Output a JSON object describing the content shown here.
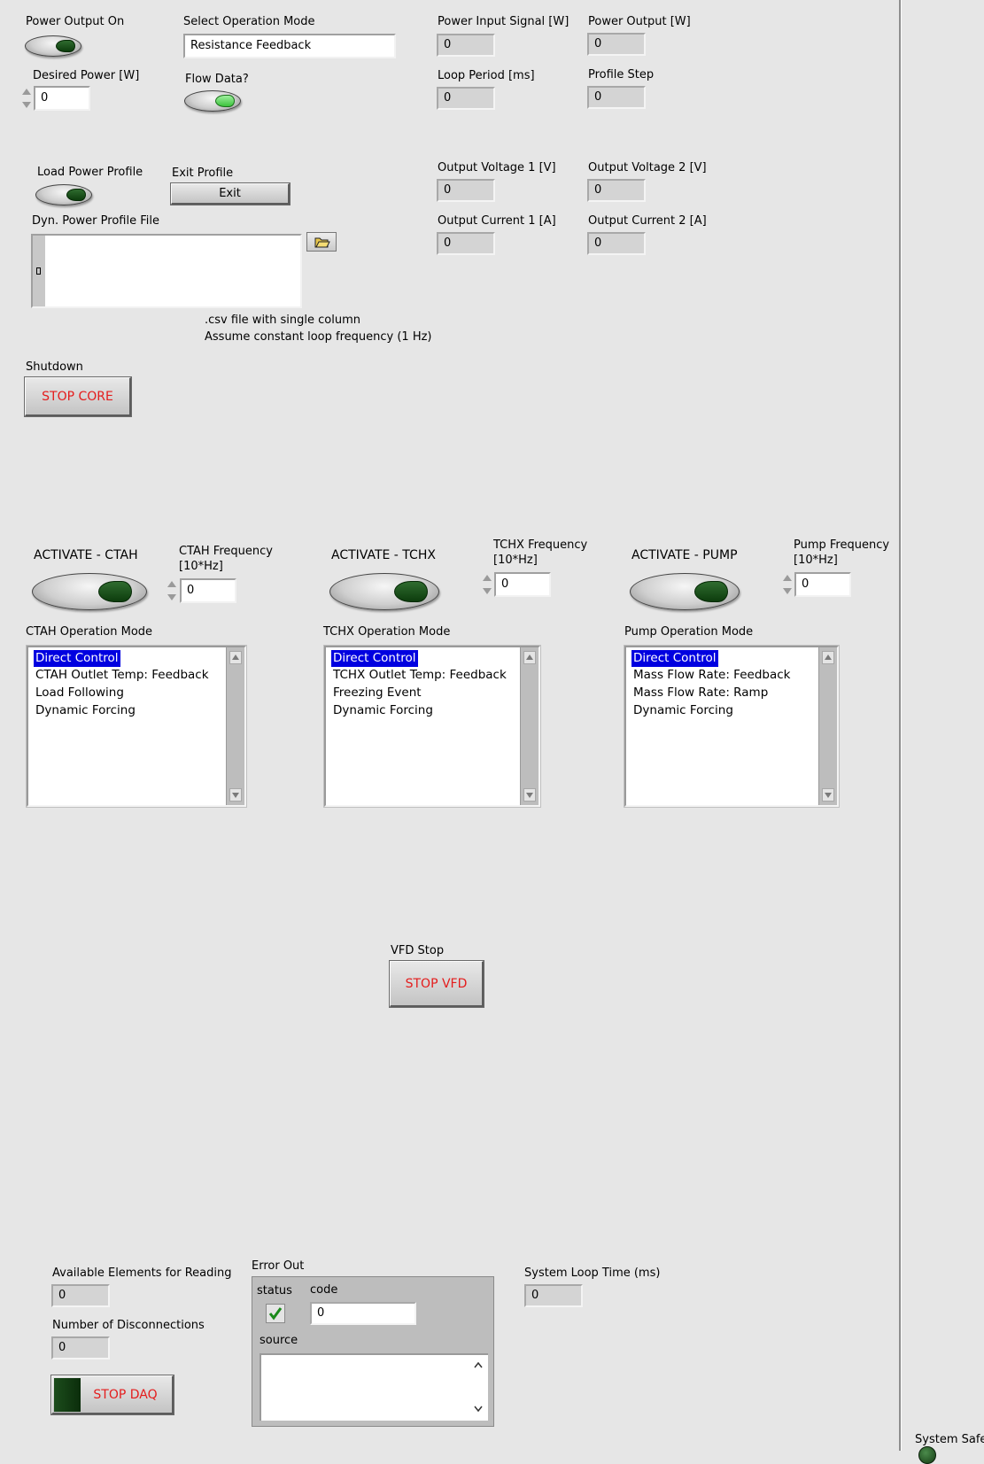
{
  "power": {
    "output_on_label": "Power Output On",
    "desired_power_label": "Desired Power [W]",
    "desired_power_value": "0",
    "mode_label": "Select Operation Mode",
    "mode_value": "Resistance Feedback",
    "flow_data_label": "Flow Data?",
    "input_signal_label": "Power Input Signal [W]",
    "input_signal_value": "0",
    "output_label": "Power Output [W]",
    "output_value": "0",
    "loop_period_label": "Loop Period [ms]",
    "loop_period_value": "0",
    "profile_step_label": "Profile Step",
    "profile_step_value": "0",
    "voltage1_label": "Output Voltage 1 [V]",
    "voltage1_value": "0",
    "voltage2_label": "Output Voltage 2 [V]",
    "voltage2_value": "0",
    "current1_label": "Output Current 1 [A]",
    "current1_value": "0",
    "current2_label": "Output Current 2 [A]",
    "current2_value": "0"
  },
  "profile": {
    "load_label": "Load Power Profile",
    "exit_label": "Exit Profile",
    "exit_button": "Exit",
    "file_label": "Dyn. Power Profile File",
    "note_line1": ".csv file with single column",
    "note_line2": "Assume constant loop frequency (1 Hz)"
  },
  "shutdown": {
    "label": "Shutdown",
    "button": "STOP CORE"
  },
  "ctah": {
    "activate_label": "ACTIVATE - CTAH",
    "freq_label_1": "CTAH Frequency",
    "freq_label_2": "[10*Hz]",
    "freq_value": "0",
    "mode_label": "CTAH Operation Mode",
    "modes": [
      "Direct Control",
      "CTAH Outlet Temp: Feedback",
      "Load Following",
      "Dynamic Forcing"
    ]
  },
  "tchx": {
    "activate_label": "ACTIVATE - TCHX",
    "freq_label_1": "TCHX Frequency",
    "freq_label_2": "[10*Hz]",
    "freq_value": "0",
    "mode_label": "TCHX Operation Mode",
    "modes": [
      "Direct Control",
      "TCHX Outlet Temp: Feedback",
      "Freezing Event",
      "Dynamic Forcing"
    ]
  },
  "pump": {
    "activate_label": "ACTIVATE - PUMP",
    "freq_label_1": "Pump Frequency",
    "freq_label_2": "[10*Hz]",
    "freq_value": "0",
    "mode_label": "Pump Operation Mode",
    "modes": [
      "Direct Control",
      "Mass Flow Rate: Feedback",
      "Mass Flow Rate: Ramp",
      "Dynamic Forcing"
    ]
  },
  "vfd": {
    "label": "VFD Stop",
    "button": "STOP VFD"
  },
  "daq": {
    "available_label": "Available Elements for Reading",
    "available_value": "0",
    "disconnections_label": "Number of Disconnections",
    "disconnections_value": "0",
    "stop_button": "STOP DAQ",
    "loop_time_label": "System Loop Time (ms)",
    "loop_time_value": "0"
  },
  "error_out": {
    "label": "Error Out",
    "status_label": "status",
    "code_label": "code",
    "code_value": "0",
    "source_label": "source"
  },
  "system": {
    "safe_label": "System Safe"
  },
  "colors": {
    "background": "#e6e6e6",
    "stop_text": "#e41c1c",
    "list_selection": "#0000e0"
  }
}
